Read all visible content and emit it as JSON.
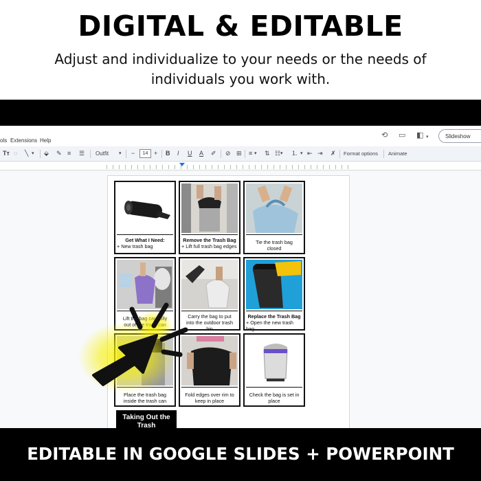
{
  "header": {
    "headline": "DIGITAL & EDITABLE",
    "subline": "Adjust and individualize to your needs or the needs of individuals you work with."
  },
  "footer": {
    "text": "EDITABLE IN GOOGLE SLIDES + POWERPOINT"
  },
  "app": {
    "menu": [
      "ols",
      "Extensions",
      "Help"
    ],
    "slideshow_label": "Slideshow",
    "font_name": "Outfit",
    "font_size": "14",
    "format_options_label": "Format options",
    "animate_label": "Animate"
  },
  "cards": [
    {
      "title": "Get What I Need:",
      "sub": "+ New trash bag",
      "img": "trash-bag-roll"
    },
    {
      "title": "Remove the Trash Bag",
      "sub": "+ Lift full trash bag edges",
      "img": "remove-bag"
    },
    {
      "title": "",
      "sub": "Tie the trash bag closed",
      "img": "tie-bag"
    },
    {
      "title": "",
      "sub": "Lift the bag carefully out of the trash can",
      "img": "lift-bag"
    },
    {
      "title": "",
      "sub": "Carry the bag to put into the outdoor trash bin",
      "img": "carry-bag"
    },
    {
      "title": "Replace the Trash Bag",
      "sub": "+ Open the new trash bag",
      "img": "replace-bag"
    },
    {
      "title": "",
      "sub": "Place the trash bag inside the trash can",
      "img": "place-bag"
    },
    {
      "title": "",
      "sub": "Fold edges over rim to keep in place",
      "img": "fold-edges"
    },
    {
      "title": "",
      "sub": "Check the bag is set in place",
      "img": "check-bag"
    }
  ],
  "title_card": {
    "text": "Taking Out the Trash"
  },
  "colors": {
    "band": "#000000",
    "highlight": "#f5f000",
    "accent_blue": "#1a73e8"
  }
}
